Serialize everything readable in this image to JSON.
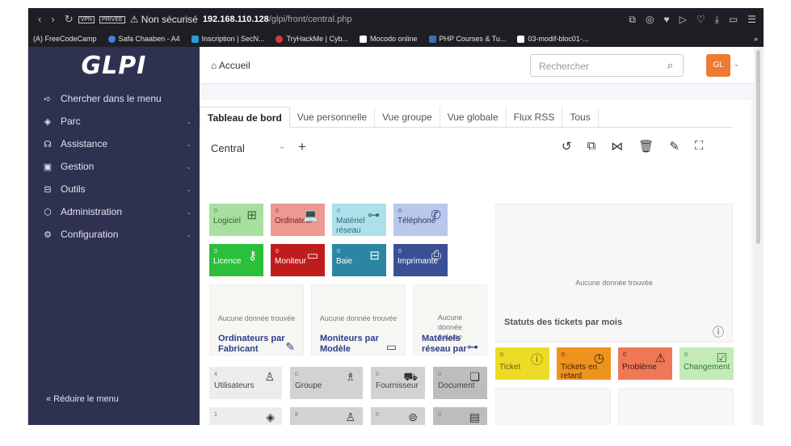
{
  "browser": {
    "vpn_tag": "VPN",
    "private_tag": "PRIVÉE",
    "security_text": "⚠ Non sécurisé",
    "url_host": "192.168.110.128",
    "url_path": "/glpi/front/central.php",
    "bookmarks": [
      {
        "label": "(A) FreeCodeCamp",
        "color": ""
      },
      {
        "label": "Safa Chaaben - A4",
        "color": "#4a7be0"
      },
      {
        "label": "Inscription | SecN...",
        "color": "#2a9bd8"
      },
      {
        "label": "TryHackMe | Cyb...",
        "color": "#d63a3a"
      },
      {
        "label": "Mocodo online",
        "color": "#ffffff"
      },
      {
        "label": "PHP Courses & Tu...",
        "color": "#3c6fb3"
      },
      {
        "label": "03-modif-bloc01-...",
        "color": "#ffffff"
      }
    ],
    "more": "»"
  },
  "sidebar": {
    "logo": "GLPI",
    "items": [
      {
        "label": "Chercher dans le menu",
        "icon": "➪",
        "chevron": ""
      },
      {
        "label": "Parc",
        "icon": "◈",
        "chevron": "⌄"
      },
      {
        "label": "Assistance",
        "icon": "☊",
        "chevron": "⌄"
      },
      {
        "label": "Gestion",
        "icon": "▣",
        "chevron": "⌄"
      },
      {
        "label": "Outils",
        "icon": "⊟",
        "chevron": "⌄"
      },
      {
        "label": "Administration",
        "icon": "⬡",
        "chevron": "⌄"
      },
      {
        "label": "Configuration",
        "icon": "⚙",
        "chevron": "⌄"
      }
    ],
    "collapse_label": "«  Réduire le menu"
  },
  "header": {
    "home_label": "⌂ Accueil",
    "search_placeholder": "Rechercher",
    "avatar": "GL"
  },
  "main": {
    "tabs": [
      "Tableau de bord",
      "Vue personnelle",
      "Vue groupe",
      "Vue globale",
      "Flux RSS",
      "Tous"
    ],
    "dashboard_select": "Central",
    "colors": {
      "logiciel": "#a7dfa1",
      "ordinateur": "#ec998f",
      "materiel": "#aee0ea",
      "telephone": "#b7c8ea",
      "licence": "#2bbf3b",
      "moniteur": "#c11c1c",
      "baie": "#2b86a3",
      "imprimante": "#3b4f94",
      "ticket": "#ecdc27",
      "retard": "#ee9320",
      "probleme": "#ef7858",
      "changement": "#c4eab8"
    },
    "top_cards": [
      {
        "name": "logiciel",
        "count": "0",
        "label": "Logiciel",
        "icon": "⊞"
      },
      {
        "name": "ordinateur",
        "count": "0",
        "label": "Ordinateur",
        "icon": "💻"
      },
      {
        "name": "materiel-reseau",
        "count": "0",
        "label": "Matériel réseau",
        "icon": "⊶"
      },
      {
        "name": "telephone",
        "count": "0",
        "label": "Téléphone",
        "icon": "✆"
      },
      {
        "name": "licence",
        "count": "0",
        "label": "Licence",
        "icon": "⚷"
      },
      {
        "name": "moniteur",
        "count": "0",
        "label": "Moniteur",
        "icon": "▭"
      },
      {
        "name": "baie",
        "count": "0",
        "label": "Baie",
        "icon": "⊟"
      },
      {
        "name": "imprimante",
        "count": "0",
        "label": "Imprimante",
        "icon": "⎙"
      }
    ],
    "no_data": "Aucune donnée trouvée",
    "panels": [
      {
        "title": "Ordinateurs par Fabricant",
        "icon": "✎"
      },
      {
        "title": "Moniteurs par Modèle",
        "icon": "▭"
      },
      {
        "title": "Matériels réseau par",
        "icon": "⊶"
      }
    ],
    "ticket_status_title": "Statuts des tickets par mois",
    "ticket_status_icon": "ⓘ",
    "gray_cards": [
      {
        "count": "4",
        "label": "Utilisateurs",
        "icon": "♙"
      },
      {
        "count": "0",
        "label": "Groupe",
        "icon": "♗"
      },
      {
        "count": "0",
        "label": "Fournisseur",
        "icon": "⛟"
      },
      {
        "count": "0",
        "label": "Document",
        "icon": "❏"
      },
      {
        "count": "1",
        "label": "",
        "icon": "◈"
      },
      {
        "count": "8",
        "label": "",
        "icon": "♙"
      },
      {
        "count": "0",
        "label": "",
        "icon": "⊚"
      },
      {
        "count": "0",
        "label": "",
        "icon": "▤"
      }
    ],
    "ticket_cards": [
      {
        "count": "0",
        "label": "Ticket",
        "icon": "ⓘ"
      },
      {
        "count": "0",
        "label": "Tickets en retard",
        "icon": "◷"
      },
      {
        "count": "0",
        "label": "Problème",
        "icon": "⚠"
      },
      {
        "count": "0",
        "label": "Changement",
        "icon": "☑"
      }
    ]
  }
}
